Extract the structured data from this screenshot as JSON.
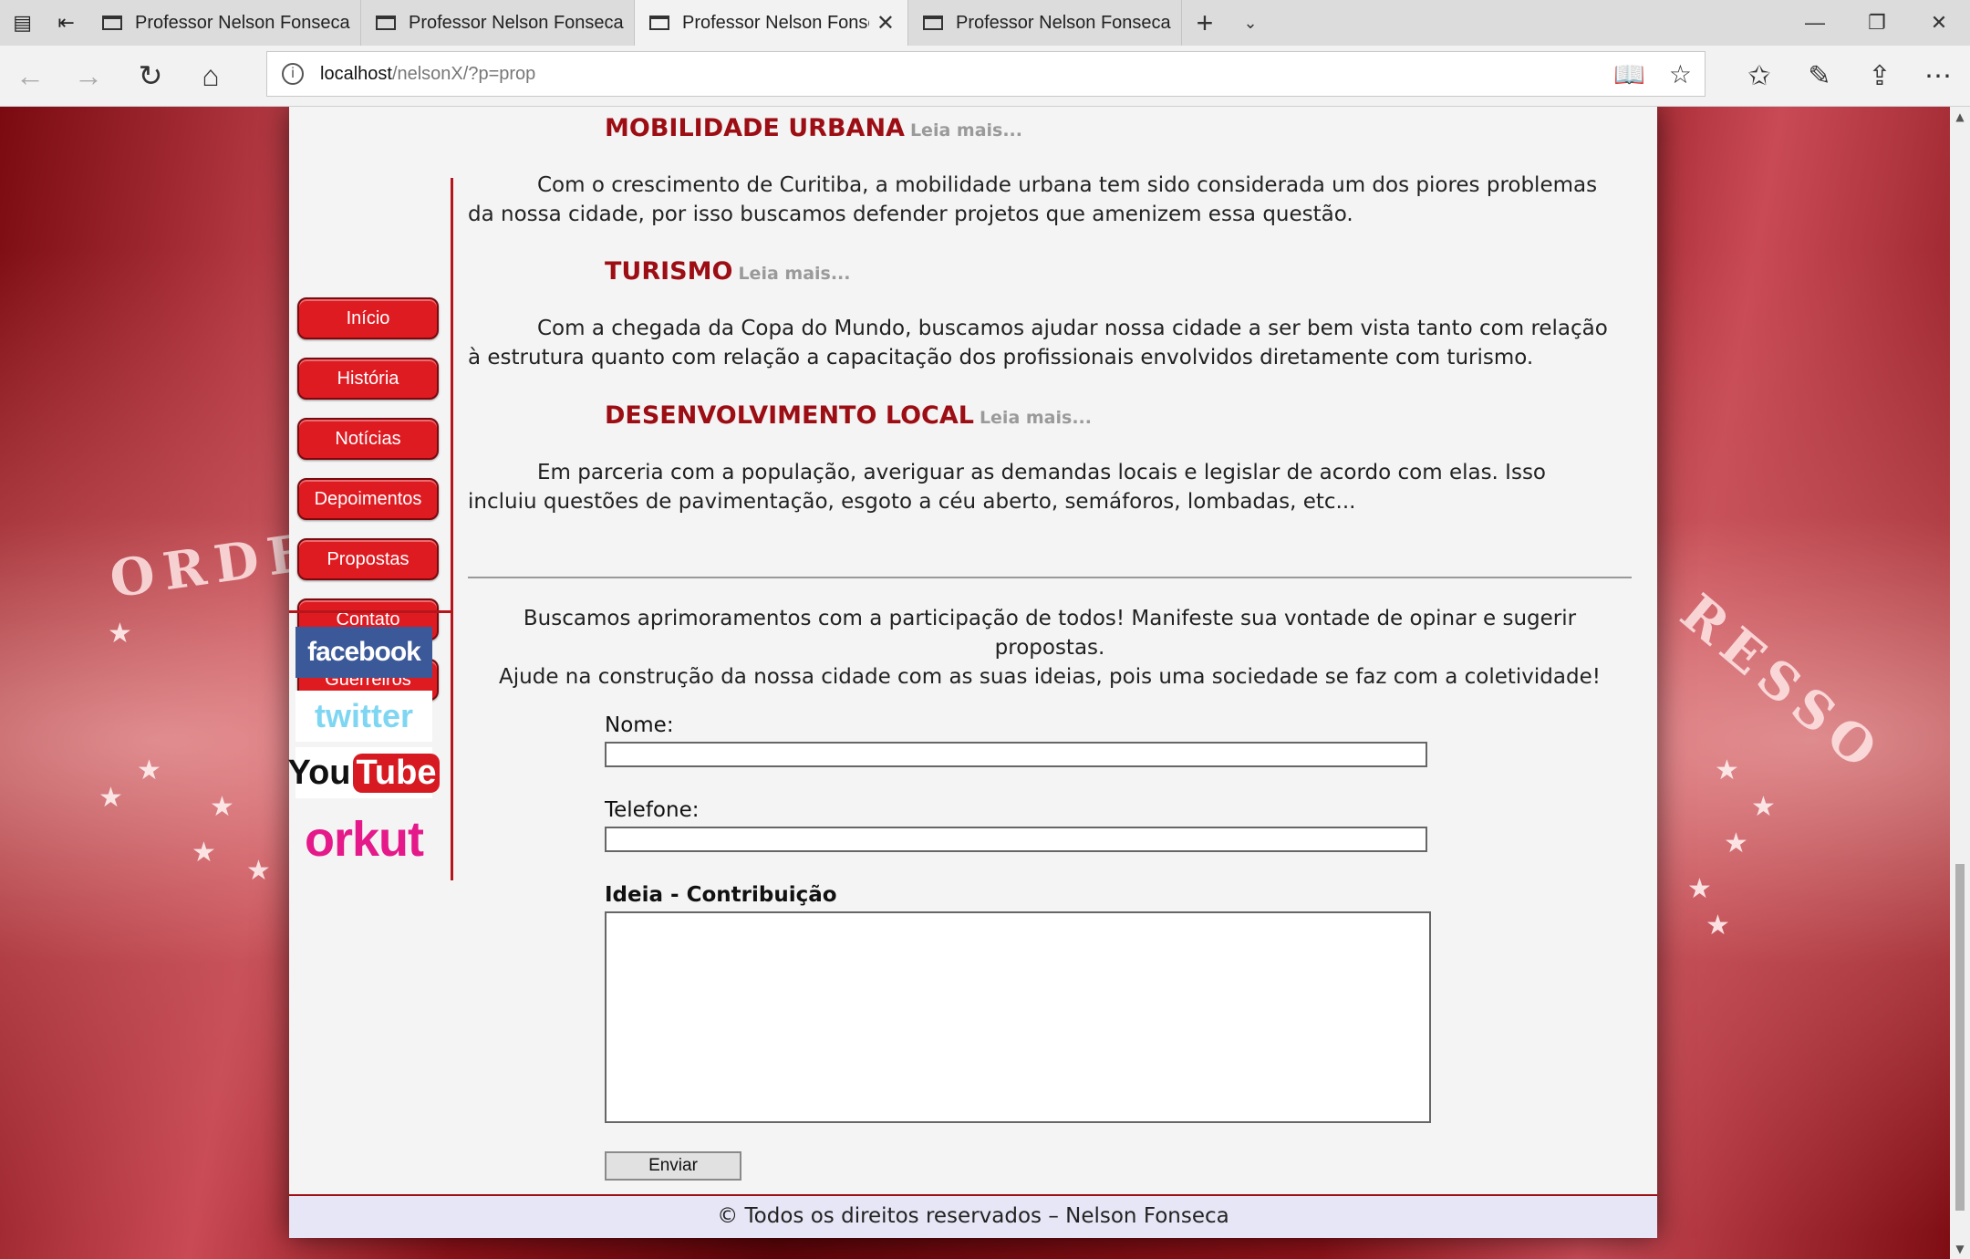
{
  "browser": {
    "tabs": [
      {
        "label": "Professor Nelson Fonseca",
        "active": false
      },
      {
        "label": "Professor Nelson Fonseca",
        "active": false
      },
      {
        "label": "Professor Nelson Fonse",
        "active": true
      },
      {
        "label": "Professor Nelson Fonseca",
        "active": false
      }
    ],
    "url_host": "localhost",
    "url_path": "/nelsonX/?p=prop"
  },
  "background": {
    "flag_text_left": "ORDE",
    "flag_text_right": "RESSO"
  },
  "sidebar": {
    "menu": [
      "Início",
      "História",
      "Notícias",
      "Depoimentos",
      "Propostas",
      "Contato",
      "Guerreiros"
    ],
    "social": {
      "facebook": "facebook",
      "twitter": "twitter",
      "youtube_you": "You",
      "youtube_tube": "Tube",
      "orkut": "orkut"
    }
  },
  "proposals": [
    {
      "title": "MOBILIDADE URBANA",
      "more": "Leia mais...",
      "text": "Com o crescimento de Curitiba, a mobilidade urbana tem sido considerada um dos piores problemas da nossa cidade, por isso buscamos defender projetos que amenizem essa questão."
    },
    {
      "title": "TURISMO",
      "more": "Leia mais...",
      "text": "Com a chegada da Copa do Mundo, buscamos ajudar nossa cidade a ser bem vista tanto com relação à estrutura quanto com relação a capacitação dos profissionais envolvidos diretamente com turismo."
    },
    {
      "title": "DESENVOLVIMENTO LOCAL",
      "more": "Leia mais...",
      "text": "Em parceria com a população, averiguar as demandas locais e legislar de acordo com elas. Isso incluiu questões de pavimentação, esgoto a céu aberto, semáforos, lombadas, etc..."
    }
  ],
  "intro": {
    "line1": "Buscamos aprimoramentos com a participação de todos! Manifeste sua vontade de opinar e sugerir propostas.",
    "line2": "Ajude na construção da nossa cidade com as suas ideias, pois uma sociedade se faz com a coletividade!"
  },
  "form": {
    "name_label": "Nome:",
    "name_value": "",
    "phone_label": "Telefone:",
    "phone_value": "",
    "idea_label": "Ideia - Contribuição",
    "idea_value": "",
    "submit": "Enviar"
  },
  "footer": "© Todos os direitos reservados – Nelson Fonseca"
}
